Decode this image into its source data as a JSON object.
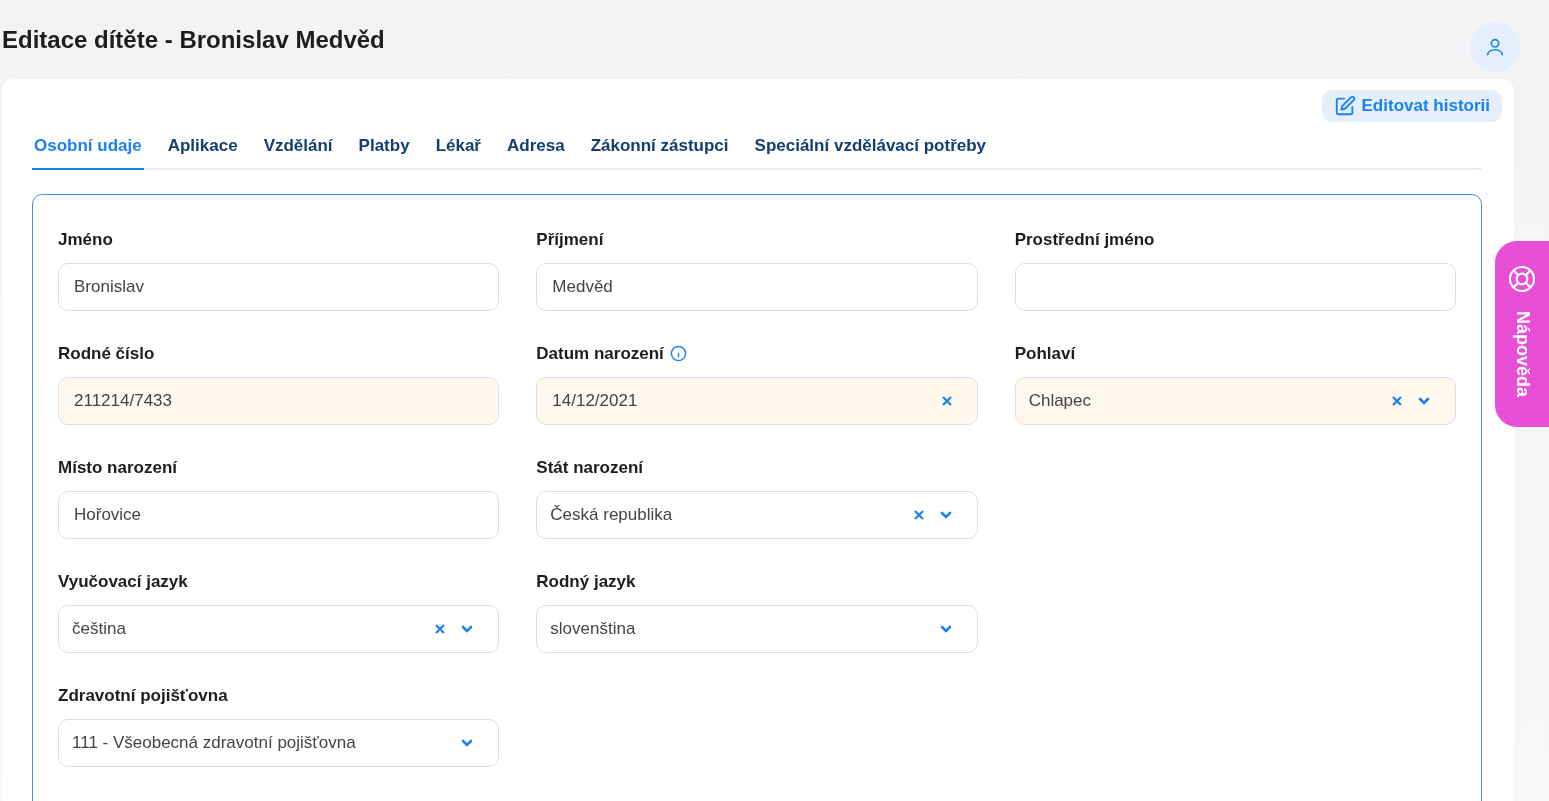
{
  "page_title": "Editace dítěte - Bronislav Medvěd",
  "edit_history_button": "Editovat historii",
  "tabs": [
    {
      "label": "Osobní udaje",
      "selected": true
    },
    {
      "label": "Aplikace",
      "selected": false
    },
    {
      "label": "Vzdělání",
      "selected": false
    },
    {
      "label": "Platby",
      "selected": false
    },
    {
      "label": "Lékař",
      "selected": false
    },
    {
      "label": "Adresa",
      "selected": false
    },
    {
      "label": "Zákonní zástupci",
      "selected": false
    },
    {
      "label": "Speciální vzdělávací potřeby",
      "selected": false
    }
  ],
  "form_rows": [
    [
      {
        "label": "Jméno",
        "kind": "text",
        "value": "Bronislav",
        "highlighted": false,
        "info": false,
        "clearable": false
      },
      {
        "label": "Příjmení",
        "kind": "text",
        "value": "Medvěd",
        "highlighted": false,
        "info": false,
        "clearable": false
      },
      {
        "label": "Prostřední jméno",
        "kind": "text",
        "highlighted": false,
        "info": false,
        "clearable": false
      }
    ],
    [
      {
        "label": "Rodné číslo",
        "kind": "text",
        "value": "211214/7433",
        "highlighted": true,
        "info": false,
        "clearable": false
      },
      {
        "label": "Datum narození",
        "kind": "date",
        "value": "14/12/2021",
        "highlighted": true,
        "info": true,
        "clearable": true
      },
      {
        "label": "Pohlaví",
        "kind": "select",
        "value": "Chlapec",
        "highlighted": true,
        "info": false,
        "clearable": true
      }
    ],
    [
      {
        "label": "Místo narození",
        "kind": "text",
        "value": "Hořovice",
        "highlighted": false,
        "info": false,
        "clearable": false
      },
      {
        "label": "Stát narození",
        "kind": "select",
        "value": "Česká republika",
        "highlighted": false,
        "info": false,
        "clearable": true
      }
    ],
    [
      {
        "label": "Vyučovací jazyk",
        "kind": "select",
        "value": "čeština",
        "highlighted": false,
        "info": false,
        "clearable": true
      },
      {
        "label": "Rodný jazyk",
        "kind": "select",
        "value": "slovenština",
        "highlighted": false,
        "info": false,
        "clearable": false
      }
    ],
    [
      {
        "label": "Zdravotní pojišťovna",
        "kind": "select",
        "value": "111 - Všeobecná zdravotní pojišťovna",
        "highlighted": false,
        "info": false,
        "clearable": false
      }
    ]
  ],
  "help_tab": "Nápověda"
}
